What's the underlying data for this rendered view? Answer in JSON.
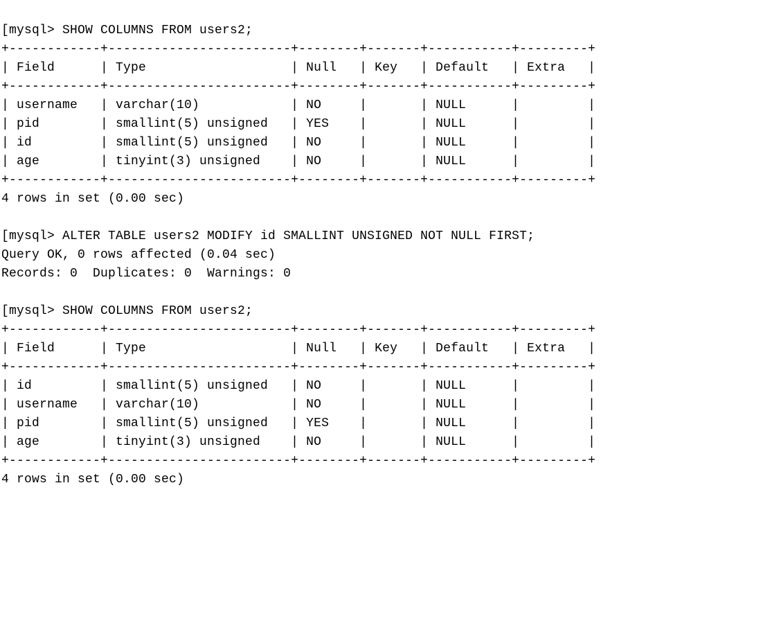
{
  "prompt": "mysql> ",
  "prompt_prefix": "[",
  "queries": [
    {
      "command": "SHOW COLUMNS FROM users2;",
      "table": {
        "headers": [
          "Field",
          "Type",
          "Null",
          "Key",
          "Default",
          "Extra"
        ],
        "rows": [
          {
            "Field": "username",
            "Type": "varchar(10)",
            "Null": "NO",
            "Key": "",
            "Default": "NULL",
            "Extra": ""
          },
          {
            "Field": "pid",
            "Type": "smallint(5) unsigned",
            "Null": "YES",
            "Key": "",
            "Default": "NULL",
            "Extra": ""
          },
          {
            "Field": "id",
            "Type": "smallint(5) unsigned",
            "Null": "NO",
            "Key": "",
            "Default": "NULL",
            "Extra": ""
          },
          {
            "Field": "age",
            "Type": "tinyint(3) unsigned",
            "Null": "NO",
            "Key": "",
            "Default": "NULL",
            "Extra": ""
          }
        ],
        "widths": {
          "Field": 10,
          "Type": 22,
          "Null": 6,
          "Key": 5,
          "Default": 9,
          "Extra": 7
        }
      },
      "summary": "4 rows in set (0.00 sec)",
      "trailing_blank": true
    },
    {
      "command": "ALTER TABLE users2 MODIFY id SMALLINT UNSIGNED NOT NULL FIRST;",
      "result_lines": [
        "Query OK, 0 rows affected (0.04 sec)",
        "Records: 0  Duplicates: 0  Warnings: 0"
      ],
      "trailing_blank": true
    },
    {
      "command": "SHOW COLUMNS FROM users2;",
      "table": {
        "headers": [
          "Field",
          "Type",
          "Null",
          "Key",
          "Default",
          "Extra"
        ],
        "rows": [
          {
            "Field": "id",
            "Type": "smallint(5) unsigned",
            "Null": "NO",
            "Key": "",
            "Default": "NULL",
            "Extra": ""
          },
          {
            "Field": "username",
            "Type": "varchar(10)",
            "Null": "NO",
            "Key": "",
            "Default": "NULL",
            "Extra": ""
          },
          {
            "Field": "pid",
            "Type": "smallint(5) unsigned",
            "Null": "YES",
            "Key": "",
            "Default": "NULL",
            "Extra": ""
          },
          {
            "Field": "age",
            "Type": "tinyint(3) unsigned",
            "Null": "NO",
            "Key": "",
            "Default": "NULL",
            "Extra": ""
          }
        ],
        "widths": {
          "Field": 10,
          "Type": 22,
          "Null": 6,
          "Key": 5,
          "Default": 9,
          "Extra": 7
        }
      },
      "summary": "4 rows in set (0.00 sec)",
      "summary_cutoff": true
    }
  ]
}
